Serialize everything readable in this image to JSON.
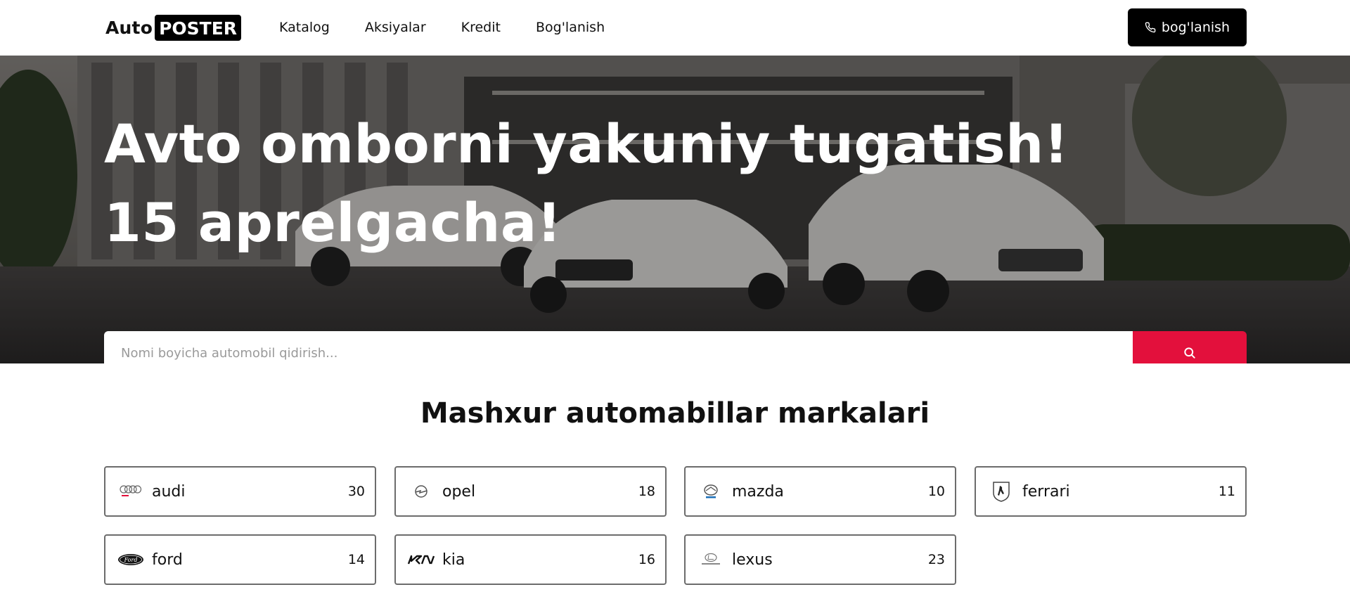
{
  "header": {
    "logo_auto": "Auto",
    "logo_poster": "POSTER",
    "nav": [
      {
        "label": "Katalog"
      },
      {
        "label": "Aksiyalar"
      },
      {
        "label": "Kredit"
      },
      {
        "label": "Bog'lanish"
      }
    ],
    "contact_label": "bog'lanish"
  },
  "hero": {
    "title_line1": "Avto omborni yakuniy tugatish!",
    "title_line2": "15 aprelgacha!",
    "search_placeholder": "Nomi boyicha automobil qidirish..."
  },
  "brands": {
    "title": "Mashxur automabillar markalari",
    "items": [
      {
        "name": "audi",
        "count": "30",
        "icon": "audi-logo-icon"
      },
      {
        "name": "opel",
        "count": "18",
        "icon": "opel-logo-icon"
      },
      {
        "name": "mazda",
        "count": "10",
        "icon": "mazda-logo-icon"
      },
      {
        "name": "ferrari",
        "count": "11",
        "icon": "ferrari-logo-icon"
      },
      {
        "name": "ford",
        "count": "14",
        "icon": "ford-logo-icon"
      },
      {
        "name": "kia",
        "count": "16",
        "icon": "kia-logo-icon"
      },
      {
        "name": "lexus",
        "count": "23",
        "icon": "lexus-logo-icon"
      }
    ]
  },
  "colors": {
    "accent": "#e3103c",
    "dark": "#000000"
  }
}
